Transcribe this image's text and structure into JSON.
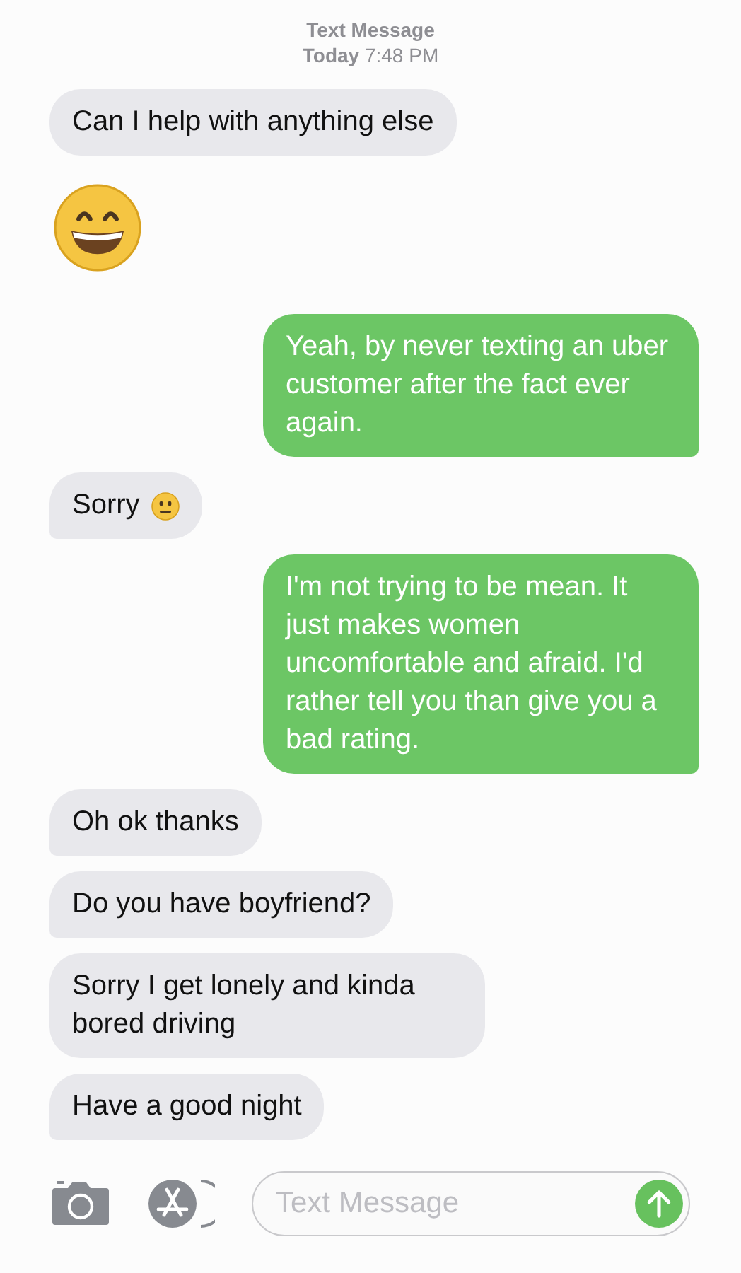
{
  "header": {
    "service": "Text Message",
    "timestamp": "**Today** 7:48 PM"
  },
  "messages": [
    {
      "sent": false,
      "kind": "text",
      "text": "Can I help with anything else",
      "tail": false
    },
    {
      "kind": "emoji"
    },
    {
      "sent": true,
      "kind": "text",
      "text": "Yeah, by never texting an uber customer after the fact ever again.",
      "tail": true
    },
    {
      "sent": false,
      "kind": "text_emoji",
      "text": "Sorry",
      "tail": true
    },
    {
      "sent": true,
      "kind": "text",
      "text": "I'm not trying to be mean. It just makes women uncomfortable and afraid. I'd rather tell you than give you a bad rating.",
      "tail": true
    },
    {
      "sent": false,
      "kind": "text",
      "text": "Oh ok thanks",
      "tail": true
    },
    {
      "sent": false,
      "kind": "text",
      "text": "Do you have boyfriend?",
      "tail": true
    },
    {
      "sent": false,
      "kind": "text",
      "text": "Sorry I get lonely and kinda bored driving",
      "tail": false
    },
    {
      "sent": false,
      "kind": "text",
      "text": "Have a good night",
      "tail": true
    }
  ],
  "composer": {
    "placeholder": "Text Message"
  }
}
